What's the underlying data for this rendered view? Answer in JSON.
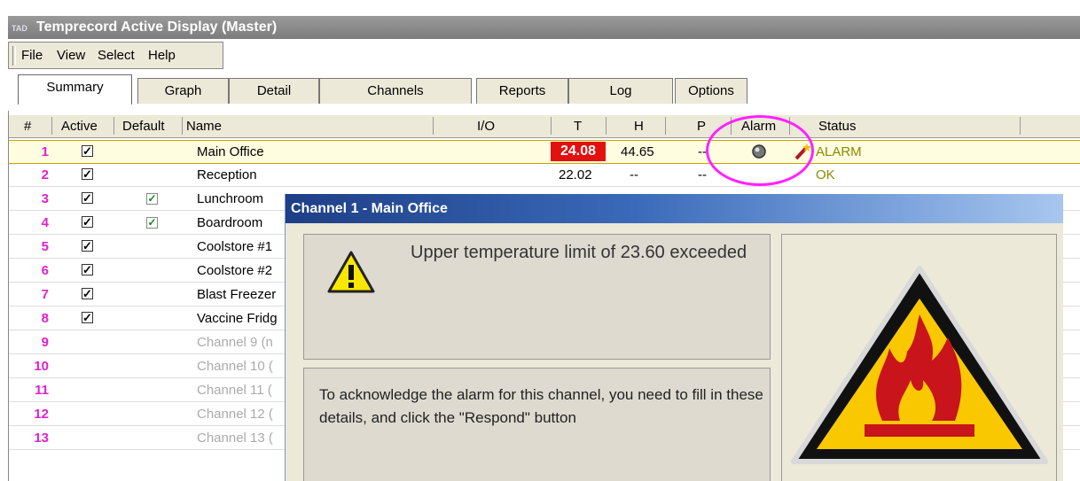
{
  "window": {
    "logo": "TAD",
    "title": "Temprecord Active Display (Master)"
  },
  "menu": [
    "File",
    "View",
    "Select",
    "Help"
  ],
  "tabs": [
    "Summary",
    "Graph",
    "Detail",
    "Channels",
    "Reports",
    "Log",
    "Options"
  ],
  "active_tab": "Summary",
  "columns": [
    "#",
    "Active",
    "Default",
    "Name",
    "I/O",
    "T",
    "H",
    "P",
    "Alarm",
    "Status"
  ],
  "rows": [
    {
      "num": "1",
      "active": true,
      "default": false,
      "name": "Main Office",
      "T": "24.08",
      "H": "44.65",
      "P": "--",
      "status": "ALARM"
    },
    {
      "num": "2",
      "active": true,
      "default": false,
      "name": "Reception",
      "T": "22.02",
      "H": "--",
      "P": "--",
      "status": "OK"
    },
    {
      "num": "3",
      "active": true,
      "default": true,
      "name": "Lunchroom"
    },
    {
      "num": "4",
      "active": true,
      "default": true,
      "name": "Boardroom"
    },
    {
      "num": "5",
      "active": true,
      "default": false,
      "name": "Coolstore #1"
    },
    {
      "num": "6",
      "active": true,
      "default": false,
      "name": "Coolstore #2"
    },
    {
      "num": "7",
      "active": true,
      "default": false,
      "name": "Blast Freezer"
    },
    {
      "num": "8",
      "active": true,
      "default": false,
      "name": "Vaccine Fridg"
    },
    {
      "num": "9",
      "active": false,
      "default": false,
      "name": "Channel 9 (n"
    },
    {
      "num": "10",
      "active": false,
      "default": false,
      "name": "Channel 10 ("
    },
    {
      "num": "11",
      "active": false,
      "default": false,
      "name": "Channel 11 ("
    },
    {
      "num": "12",
      "active": false,
      "default": false,
      "name": "Channel 12 ("
    },
    {
      "num": "13",
      "active": false,
      "default": false,
      "name": "Channel 13 ("
    }
  ],
  "dialog": {
    "title": "Channel 1 - Main Office",
    "message": "Upper temperature limit of 23.60 exceeded",
    "instructions": "To acknowledge the alarm for this channel, you need to fill in these details, and click the \"Respond\" button"
  },
  "colors": {
    "alarm_red": "#e31010",
    "row_number": "#e020d0",
    "highlight_circle": "#ff22ff",
    "status_text": "#8a8a00"
  },
  "icons": {
    "alarm": "alarm-bell-icon",
    "respond": "magic-wand-icon",
    "warning": "warning-triangle-icon",
    "fire": "fire-warning-icon"
  }
}
